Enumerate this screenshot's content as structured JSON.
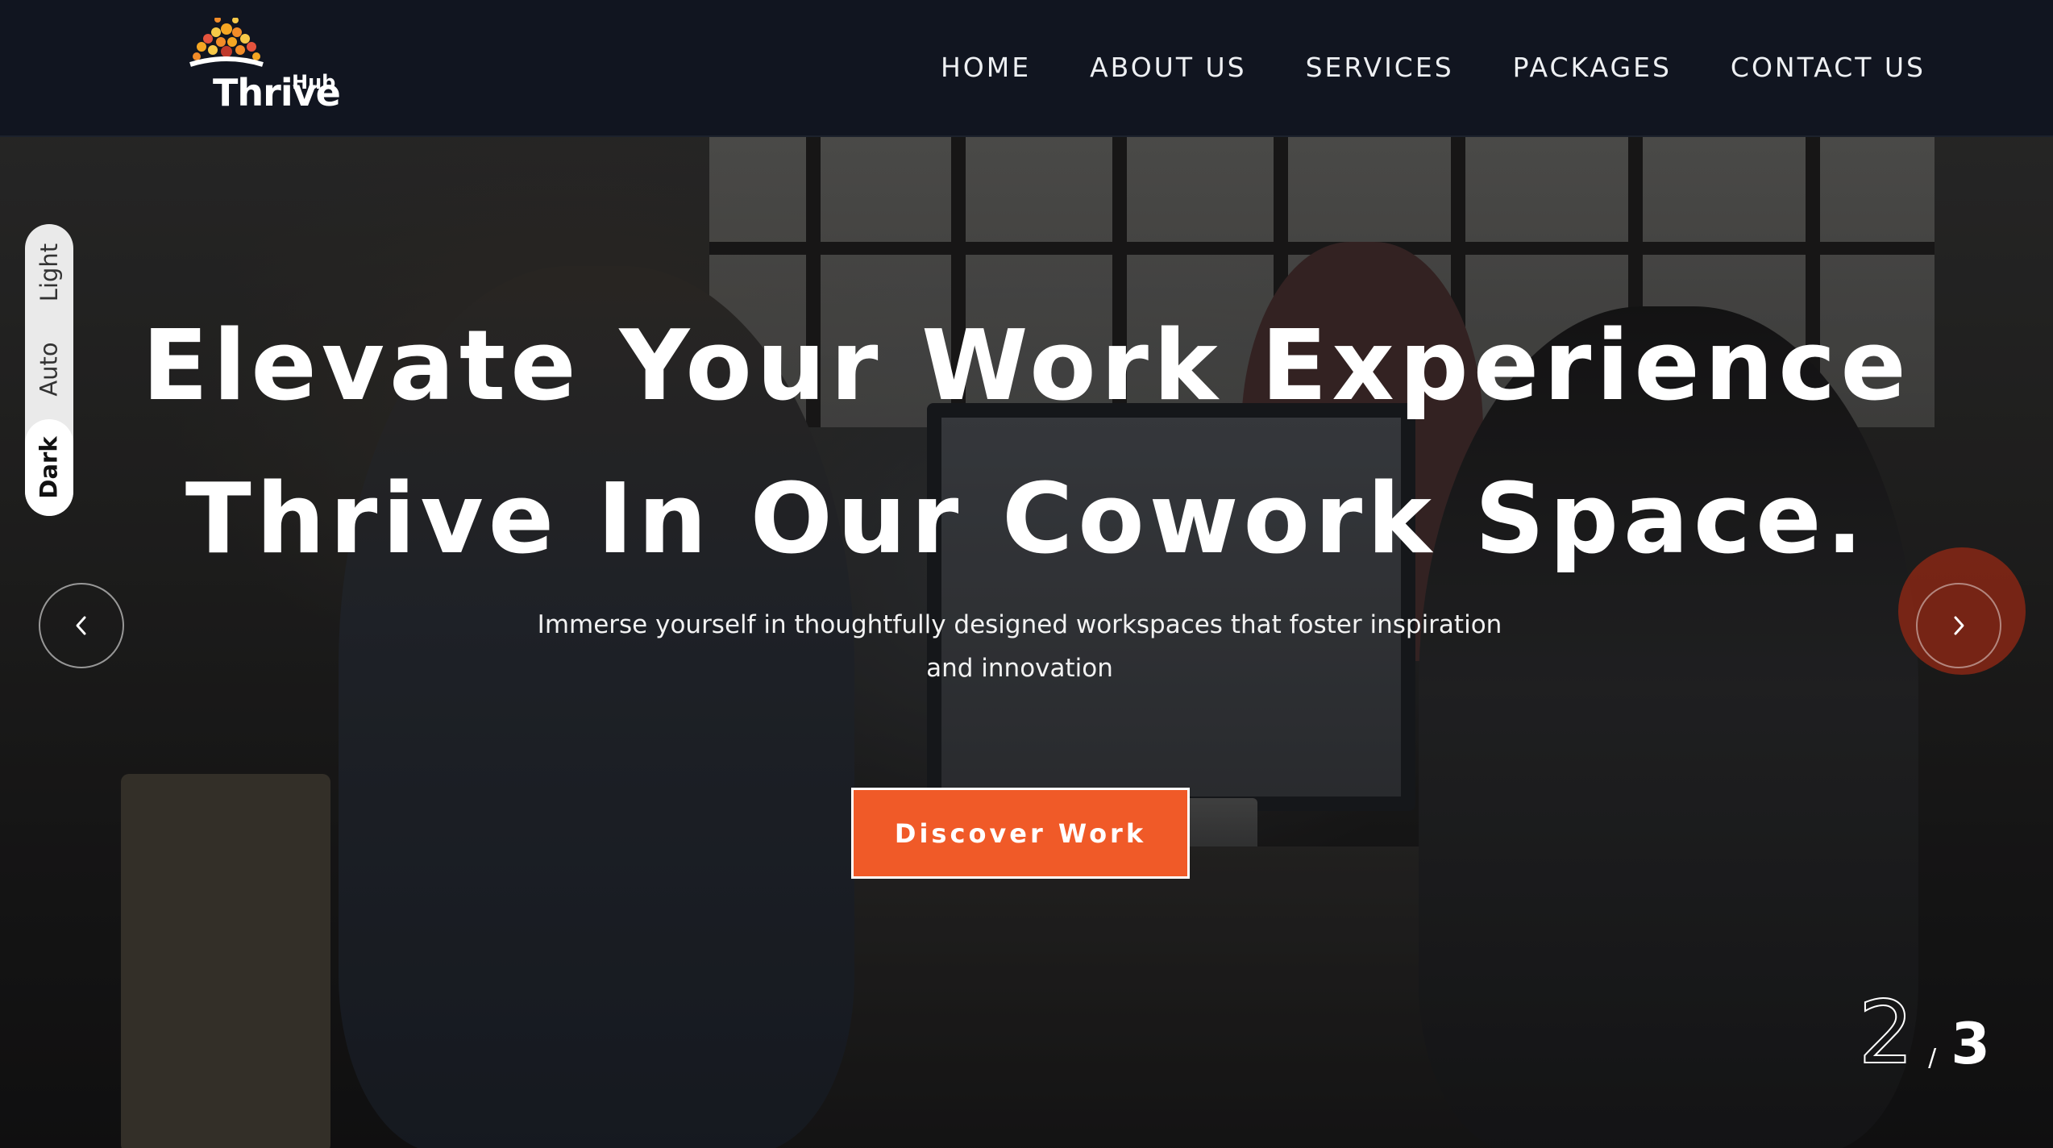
{
  "brand": {
    "name_main": "hrive",
    "name_initial": "T",
    "name_suffix": "Hub"
  },
  "nav": {
    "items": [
      {
        "label": "HOME"
      },
      {
        "label": "ABOUT US"
      },
      {
        "label": "SERVICES"
      },
      {
        "label": "PACKAGES"
      },
      {
        "label": "CONTACT US"
      }
    ]
  },
  "theme_switch": {
    "options": [
      {
        "label": "Light"
      },
      {
        "label": "Auto"
      },
      {
        "label": "Dark"
      }
    ],
    "selected": "Dark"
  },
  "hero": {
    "title_line1": "Elevate Your Work Experience",
    "title_line2": "Thrive In Our Cowork Space.",
    "subtitle": "Immerse yourself in thoughtfully designed workspaces that foster inspiration and innovation",
    "cta_label": "Discover Work"
  },
  "slider": {
    "current": "2",
    "separator": "/",
    "total": "3",
    "prev_icon": "chevron-left-icon",
    "next_icon": "chevron-right-icon"
  },
  "colors": {
    "header_bg": "#111520",
    "accent": "#f05a28",
    "next_ring": "#962814"
  }
}
